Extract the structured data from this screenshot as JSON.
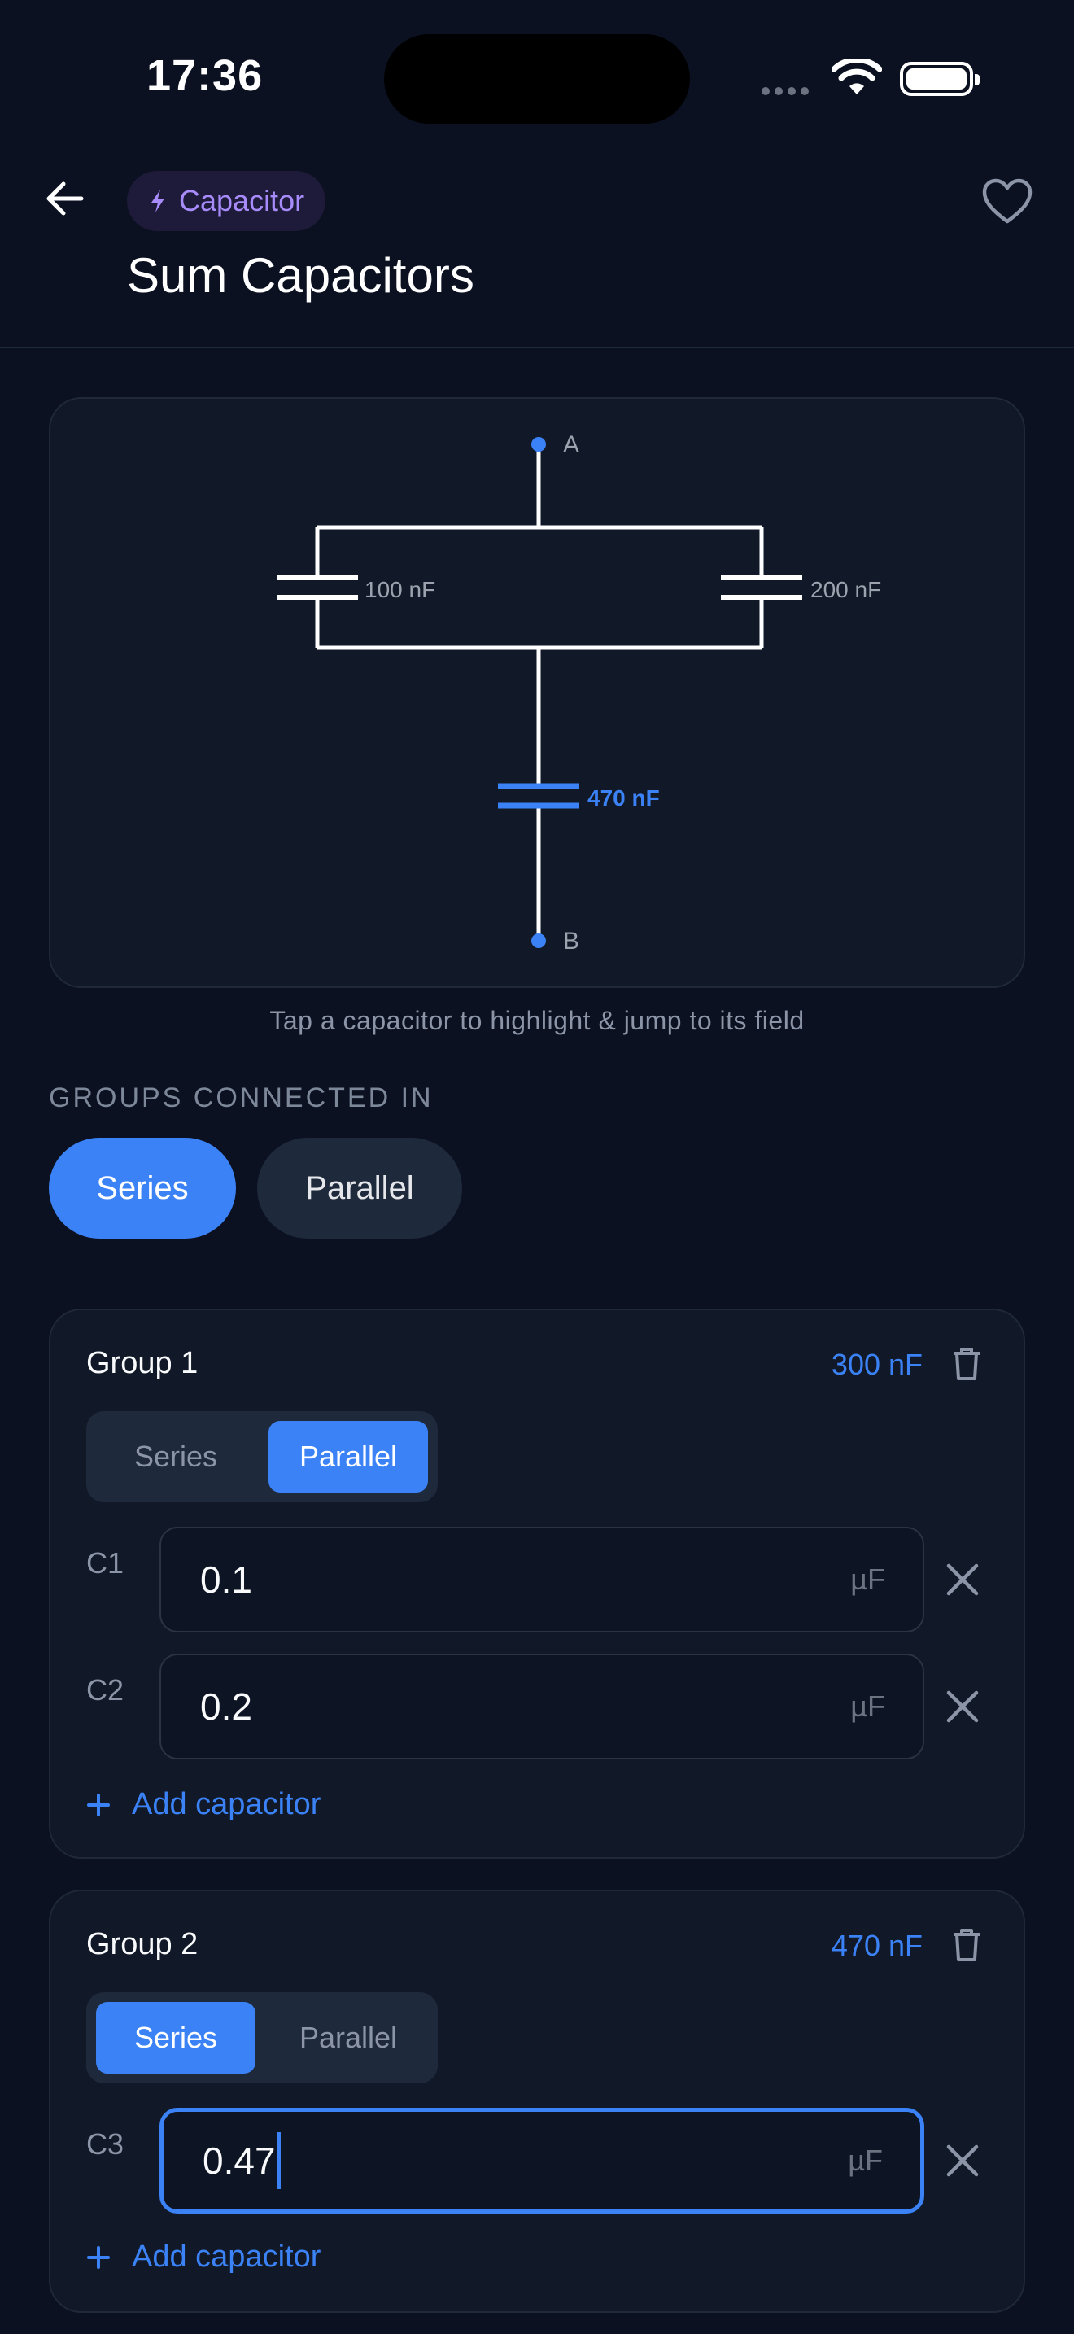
{
  "status_bar": {
    "time": "17:36"
  },
  "header": {
    "category_chip": "Capacitor",
    "title": "Sum Capacitors"
  },
  "circuit": {
    "terminal_a": "A",
    "terminal_b": "B",
    "cap1_label": "100 nF",
    "cap2_label": "200 nF",
    "cap3_label": "470 nF",
    "highlight_color": "#3b82f6",
    "hint": "Tap a capacitor to highlight & jump to its field"
  },
  "connection": {
    "label": "GROUPS CONNECTED IN",
    "options": [
      "Series",
      "Parallel"
    ],
    "selected": "Series"
  },
  "groups": [
    {
      "title": "Group 1",
      "total": "300 nF",
      "mode_options": [
        "Series",
        "Parallel"
      ],
      "selected_mode": "Parallel",
      "capacitors": [
        {
          "label": "C1",
          "value": "0.1",
          "unit": "µF"
        },
        {
          "label": "C2",
          "value": "0.2",
          "unit": "µF"
        }
      ],
      "add_label": "Add capacitor"
    },
    {
      "title": "Group 2",
      "total": "470 nF",
      "mode_options": [
        "Series",
        "Parallel"
      ],
      "selected_mode": "Series",
      "capacitors": [
        {
          "label": "C3",
          "value": "0.47",
          "unit": "µF"
        }
      ],
      "add_label": "Add capacitor"
    }
  ],
  "colors": {
    "background": "#0b1120",
    "accent": "#3b82f6",
    "chip_text": "#a78bfa"
  }
}
